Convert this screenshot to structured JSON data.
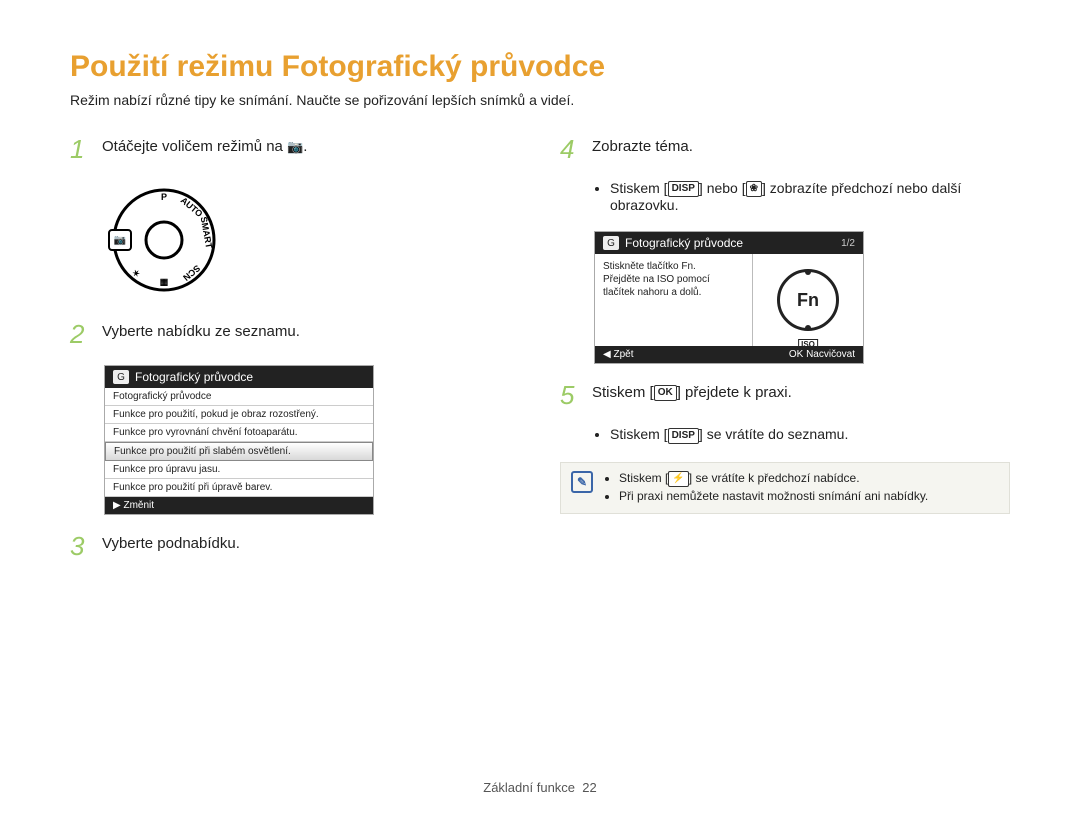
{
  "title": "Použití režimu Fotografický průvodce",
  "intro": "Režim nabízí různé tipy ke snímání. Naučte se pořizování lepších snímků a videí.",
  "steps": {
    "s1_pre": "Otáčejte voličem režimů na ",
    "s1_post": ".",
    "s2": "Vyberte nabídku ze seznamu.",
    "s3": "Vyberte podnabídku.",
    "s4": "Zobrazte téma.",
    "s4_bullet_pre": "Stiskem [",
    "s4_bullet_mid": "] nebo [",
    "s4_bullet_post": "] zobrazíte předchozí nebo další obrazovku.",
    "s5_pre": "Stiskem [",
    "s5_post": "] přejdete k praxi.",
    "s5_bullet_pre": "Stiskem [",
    "s5_bullet_post": "] se vrátíte do seznamu."
  },
  "keys": {
    "disp": "DISP",
    "ok": "OK",
    "macro": "❀",
    "flash": "⚡",
    "guide": "G"
  },
  "lcd1": {
    "header": "Fotografický průvodce",
    "rows": [
      "Fotografický průvodce",
      "Funkce pro použití, pokud je obraz rozostřený.",
      "Funkce pro vyrovnání chvění fotoaparátu.",
      "Funkce pro použití při slabém osvětlení.",
      "Funkce pro úpravu jasu.",
      "Funkce pro použití při úpravě barev."
    ],
    "selected_index": 3,
    "footer_left": "▶  Změnit"
  },
  "lcd2": {
    "header": "Fotografický průvodce",
    "corner": "1/2",
    "text_lines": [
      "Stiskněte tlačítko Fn.",
      "Přejděte na ISO pomocí",
      "tlačítek nahoru a dolů."
    ],
    "fn": "Fn",
    "iso": "ISO",
    "footer_left": "◀   Zpět",
    "footer_right": "OK   Nacvičovat"
  },
  "tip": {
    "li1_pre": "Stiskem [",
    "li1_post": "] se vrátíte k předchozí nabídce.",
    "li2": "Při praxi nemůžete nastavit možnosti snímání ani nabídky."
  },
  "footer": {
    "label": "Základní funkce",
    "page": "22"
  }
}
